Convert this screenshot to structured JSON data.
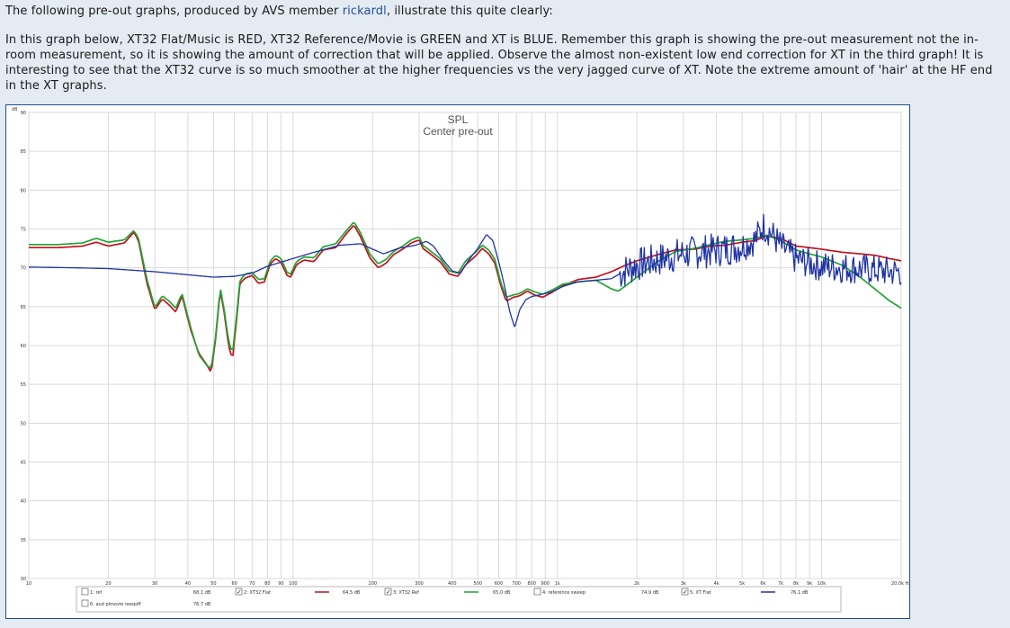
{
  "intro": {
    "text_before": "The following pre-out graphs, produced by AVS member ",
    "author_link": "rickardl",
    "text_after": ", illustrate this quite clearly:"
  },
  "paragraph": "In this graph below, XT32 Flat/Music is RED, XT32 Reference/Movie is GREEN and XT is BLUE. Remember this graph is showing the pre-out measurement not the in-room measurement, so it is showing the amount of correction that will be applied. Observe the almost non-existent low end correction for XT in the third graph!  It is interesting to see that the XT32 curve is so much smoother at the higher frequencies vs the very jagged curve of XT. Note the extreme amount of 'hair' at the HF end in the XT graphs.",
  "chart_data": {
    "type": "line",
    "title": "SPL",
    "subtitle": "Center pre-out",
    "ylabel": "dB",
    "xlabel": "Hz",
    "x_scale": "log",
    "xlim": [
      10,
      20000
    ],
    "ylim": [
      30,
      90
    ],
    "y_ticks": [
      30,
      35,
      40,
      45,
      50,
      55,
      60,
      65,
      70,
      75,
      80,
      85,
      90
    ],
    "x_ticks": [
      {
        "v": 10,
        "label": "10"
      },
      {
        "v": 20,
        "label": "20"
      },
      {
        "v": 30,
        "label": "30"
      },
      {
        "v": 40,
        "label": "40"
      },
      {
        "v": 50,
        "label": "50"
      },
      {
        "v": 60,
        "label": "60"
      },
      {
        "v": 70,
        "label": "70"
      },
      {
        "v": 80,
        "label": "80"
      },
      {
        "v": 90,
        "label": "90"
      },
      {
        "v": 100,
        "label": "100"
      },
      {
        "v": 200,
        "label": "200"
      },
      {
        "v": 300,
        "label": "300"
      },
      {
        "v": 400,
        "label": "400"
      },
      {
        "v": 500,
        "label": "500"
      },
      {
        "v": 600,
        "label": "600"
      },
      {
        "v": 700,
        "label": "700"
      },
      {
        "v": 800,
        "label": "800"
      },
      {
        "v": 900,
        "label": "900"
      },
      {
        "v": 1000,
        "label": "1k"
      },
      {
        "v": 2000,
        "label": "2k"
      },
      {
        "v": 3000,
        "label": "3k"
      },
      {
        "v": 4000,
        "label": "4k"
      },
      {
        "v": 5000,
        "label": "5k"
      },
      {
        "v": 6000,
        "label": "6k"
      },
      {
        "v": 7000,
        "label": "7k"
      },
      {
        "v": 8000,
        "label": "8k"
      },
      {
        "v": 9000,
        "label": "9k"
      },
      {
        "v": 10000,
        "label": "10k"
      },
      {
        "v": 20000,
        "label": "20,0k Hz"
      }
    ],
    "grid": true,
    "series": [
      {
        "name": "XT32 Flat",
        "color": "#c0141e",
        "noise": 0,
        "points": [
          [
            10,
            72.6
          ],
          [
            13,
            72.6
          ],
          [
            16,
            72.8
          ],
          [
            18,
            73.3
          ],
          [
            20,
            72.8
          ],
          [
            23,
            73.2
          ],
          [
            25,
            74.6
          ],
          [
            26,
            73.5
          ],
          [
            28,
            68
          ],
          [
            30,
            64.6
          ],
          [
            32,
            66
          ],
          [
            34,
            65.2
          ],
          [
            36,
            64.3
          ],
          [
            38,
            66.4
          ],
          [
            41,
            62
          ],
          [
            44,
            59
          ],
          [
            47,
            57.6
          ],
          [
            49,
            56.5
          ],
          [
            51,
            61
          ],
          [
            53,
            67.2
          ],
          [
            55,
            64
          ],
          [
            57,
            60
          ],
          [
            59,
            58.2
          ],
          [
            61,
            63
          ],
          [
            63,
            68
          ],
          [
            66,
            68.7
          ],
          [
            70,
            69
          ],
          [
            74,
            68
          ],
          [
            78,
            68.2
          ],
          [
            82,
            70.5
          ],
          [
            86,
            71.2
          ],
          [
            90,
            70.7
          ],
          [
            95,
            69
          ],
          [
            98,
            68.8
          ],
          [
            103,
            70.4
          ],
          [
            110,
            71
          ],
          [
            120,
            70.8
          ],
          [
            130,
            72.3
          ],
          [
            145,
            72.6
          ],
          [
            160,
            74.5
          ],
          [
            170,
            75.5
          ],
          [
            180,
            74
          ],
          [
            195,
            71.3
          ],
          [
            210,
            70
          ],
          [
            225,
            70.6
          ],
          [
            240,
            71.7
          ],
          [
            260,
            72.4
          ],
          [
            280,
            73.2
          ],
          [
            300,
            73.6
          ],
          [
            310,
            72.5
          ],
          [
            330,
            71.8
          ],
          [
            360,
            70.8
          ],
          [
            390,
            69.2
          ],
          [
            420,
            68.9
          ],
          [
            450,
            70.4
          ],
          [
            490,
            71.5
          ],
          [
            520,
            72.5
          ],
          [
            550,
            71.8
          ],
          [
            580,
            70.6
          ],
          [
            610,
            67.8
          ],
          [
            640,
            65.7
          ],
          [
            680,
            66.2
          ],
          [
            720,
            66.4
          ],
          [
            770,
            67
          ],
          [
            820,
            66.5
          ],
          [
            880,
            66.2
          ],
          [
            950,
            66.8
          ],
          [
            1050,
            67.7
          ],
          [
            1200,
            68.5
          ],
          [
            1400,
            68.8
          ],
          [
            1600,
            69.5
          ],
          [
            1800,
            70.3
          ],
          [
            2000,
            70.9
          ],
          [
            2400,
            71.7
          ],
          [
            2800,
            72.3
          ],
          [
            3300,
            72.4
          ],
          [
            3800,
            72.8
          ],
          [
            4300,
            72.9
          ],
          [
            5000,
            73.3
          ],
          [
            5600,
            73.5
          ],
          [
            6200,
            74.1
          ],
          [
            7000,
            73.8
          ],
          [
            8000,
            72.8
          ],
          [
            9000,
            72.6
          ],
          [
            10000,
            72.4
          ],
          [
            12000,
            72
          ],
          [
            14000,
            71.8
          ],
          [
            16000,
            71.6
          ],
          [
            18000,
            71.2
          ],
          [
            20000,
            70.9
          ]
        ]
      },
      {
        "name": "XT32 Ref",
        "color": "#23a332",
        "noise": 0,
        "points": [
          [
            10,
            73
          ],
          [
            13,
            73
          ],
          [
            16,
            73.2
          ],
          [
            18,
            73.8
          ],
          [
            20,
            73.3
          ],
          [
            23,
            73.6
          ],
          [
            25,
            74.8
          ],
          [
            26,
            73.8
          ],
          [
            28,
            68.5
          ],
          [
            30,
            64.9
          ],
          [
            32,
            66.4
          ],
          [
            34,
            65.7
          ],
          [
            36,
            64.8
          ],
          [
            38,
            66.7
          ],
          [
            41,
            62.3
          ],
          [
            44,
            58.8
          ],
          [
            47,
            57.5
          ],
          [
            49,
            57
          ],
          [
            51,
            61.3
          ],
          [
            53,
            67.5
          ],
          [
            55,
            64.4
          ],
          [
            57,
            60.6
          ],
          [
            59,
            59
          ],
          [
            61,
            63.5
          ],
          [
            63,
            68.4
          ],
          [
            66,
            69.2
          ],
          [
            70,
            69.4
          ],
          [
            74,
            68.5
          ],
          [
            78,
            68.6
          ],
          [
            82,
            70.9
          ],
          [
            86,
            71.6
          ],
          [
            90,
            71.2
          ],
          [
            95,
            69.4
          ],
          [
            98,
            69.2
          ],
          [
            103,
            70.8
          ],
          [
            110,
            71.4
          ],
          [
            120,
            71.3
          ],
          [
            130,
            72.7
          ],
          [
            145,
            73.1
          ],
          [
            160,
            74.9
          ],
          [
            170,
            75.9
          ],
          [
            180,
            74.5
          ],
          [
            195,
            71.8
          ],
          [
            210,
            70.5
          ],
          [
            225,
            71.1
          ],
          [
            240,
            72.1
          ],
          [
            260,
            72.8
          ],
          [
            280,
            73.6
          ],
          [
            300,
            74
          ],
          [
            310,
            72.9
          ],
          [
            330,
            72.2
          ],
          [
            360,
            71.2
          ],
          [
            390,
            69.6
          ],
          [
            420,
            69.3
          ],
          [
            450,
            70.9
          ],
          [
            490,
            72
          ],
          [
            520,
            72.9
          ],
          [
            550,
            72.3
          ],
          [
            580,
            71.1
          ],
          [
            610,
            68.2
          ],
          [
            640,
            66.2
          ],
          [
            680,
            66.5
          ],
          [
            720,
            66.7
          ],
          [
            770,
            67.3
          ],
          [
            820,
            66.9
          ],
          [
            880,
            66.6
          ],
          [
            950,
            67.1
          ],
          [
            1050,
            67.9
          ],
          [
            1200,
            68.2
          ],
          [
            1400,
            68.4
          ],
          [
            1600,
            67.3
          ],
          [
            1700,
            67
          ],
          [
            1800,
            67.6
          ],
          [
            2000,
            68.8
          ],
          [
            2400,
            70.8
          ],
          [
            2800,
            72.1
          ],
          [
            3300,
            72.5
          ],
          [
            3800,
            73
          ],
          [
            4300,
            73.4
          ],
          [
            5000,
            73.6
          ],
          [
            5600,
            73.8
          ],
          [
            6200,
            74.2
          ],
          [
            7000,
            73.5
          ],
          [
            8000,
            72.3
          ],
          [
            9000,
            71.8
          ],
          [
            10000,
            71.4
          ],
          [
            12000,
            70.3
          ],
          [
            14000,
            68.8
          ],
          [
            16000,
            67.2
          ],
          [
            18000,
            65.8
          ],
          [
            20000,
            64.8
          ]
        ]
      },
      {
        "name": "XT Flat",
        "color": "#1f33a6",
        "noise": 1,
        "points": [
          [
            10,
            70.1
          ],
          [
            15,
            70
          ],
          [
            20,
            69.9
          ],
          [
            30,
            69.5
          ],
          [
            40,
            69.1
          ],
          [
            50,
            68.8
          ],
          [
            60,
            68.9
          ],
          [
            70,
            69.3
          ],
          [
            80,
            70.2
          ],
          [
            100,
            71.2
          ],
          [
            120,
            72
          ],
          [
            150,
            72.9
          ],
          [
            180,
            73.1
          ],
          [
            200,
            72.4
          ],
          [
            220,
            71.8
          ],
          [
            250,
            72.5
          ],
          [
            290,
            72.9
          ],
          [
            320,
            73.4
          ],
          [
            340,
            72.8
          ],
          [
            370,
            71
          ],
          [
            400,
            69.6
          ],
          [
            430,
            69.3
          ],
          [
            460,
            70.9
          ],
          [
            500,
            72.5
          ],
          [
            540,
            74.3
          ],
          [
            570,
            73.5
          ],
          [
            600,
            70.8
          ],
          [
            630,
            67.8
          ],
          [
            660,
            64.4
          ],
          [
            690,
            62.3
          ],
          [
            720,
            64.6
          ],
          [
            760,
            65.9
          ],
          [
            800,
            66.3
          ],
          [
            880,
            66.6
          ],
          [
            950,
            66.9
          ],
          [
            1050,
            67.6
          ],
          [
            1200,
            68.2
          ],
          [
            1400,
            68.4
          ],
          [
            1600,
            68.6
          ],
          [
            1800,
            69.6
          ],
          [
            2000,
            70.4
          ],
          [
            2400,
            71
          ],
          [
            2800,
            71.6
          ],
          [
            3300,
            72
          ],
          [
            3800,
            72.2
          ],
          [
            4300,
            72.4
          ],
          [
            5000,
            72.8
          ],
          [
            5600,
            73.6
          ],
          [
            6000,
            75.4
          ],
          [
            6400,
            74.6
          ],
          [
            7000,
            72.8
          ],
          [
            8000,
            71.1
          ],
          [
            9000,
            70.6
          ],
          [
            10000,
            70.2
          ],
          [
            12000,
            70
          ],
          [
            14000,
            69.9
          ],
          [
            16000,
            69.7
          ],
          [
            18000,
            69.5
          ],
          [
            20000,
            69.5
          ]
        ]
      }
    ],
    "legend": [
      {
        "checked": false,
        "label": "1: ref",
        "level": "68,1 dB"
      },
      {
        "checked": true,
        "label": "2: XT32 Flat",
        "level": "64,5 dB",
        "color": "#c0141e"
      },
      {
        "checked": true,
        "label": "3: XT32 Ref",
        "level": "65,0 dB",
        "color": "#23a332"
      },
      {
        "checked": false,
        "label": "4: reference sweep",
        "level": "74,9 dB"
      },
      {
        "checked": true,
        "label": "5: XT Flat",
        "level": "76,1 dB",
        "color": "#1f33a6"
      },
      {
        "checked": false,
        "label": "6: aud plmovie reeqoff",
        "level": "76,7 dB"
      }
    ],
    "legend_placement": "bottom"
  }
}
